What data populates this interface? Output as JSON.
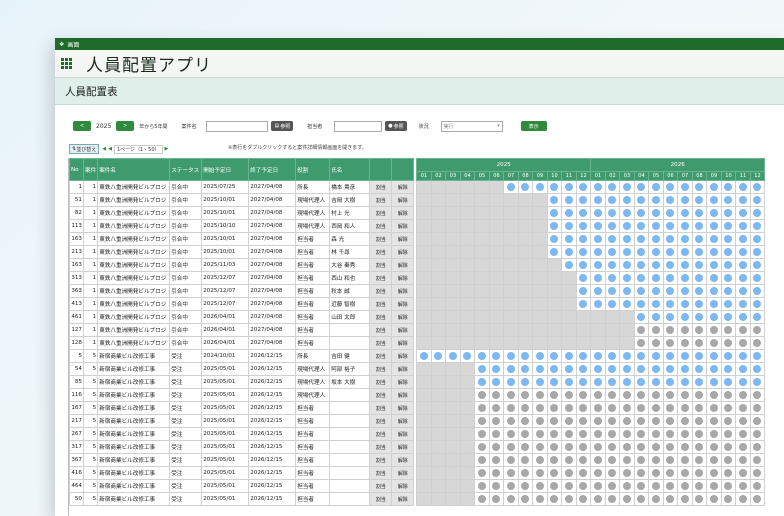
{
  "window_title": "画面",
  "app_title": "人員配置アプリ",
  "page_title": "人員配置表",
  "toolbar": {
    "prev": "<",
    "year": "2025",
    "next": ">",
    "range_label": "年から5年間",
    "project_label": "案件名",
    "project_value": "",
    "ref_label": "参照",
    "person_label": "担当者",
    "person_value": "",
    "person_ref_label": "参照",
    "status_label": "状況",
    "status_value": "実行",
    "show_label": "表示"
  },
  "pager": {
    "sort_label": "並び替え",
    "page_text": "1ページ（1 - 50）"
  },
  "note": "※表行をダブルクリックすると案件詳細情報画面を開きます。",
  "columns": [
    "No",
    "案件",
    "案件名",
    "ステータス",
    "開始予定日",
    "終了予定日",
    "役割",
    "氏名",
    "",
    ""
  ],
  "years": [
    {
      "label": "2025"
    },
    {
      "label": "2026"
    }
  ],
  "months": [
    "01",
    "02",
    "03",
    "04",
    "05",
    "06",
    "07",
    "08",
    "09",
    "10",
    "11",
    "12",
    "01",
    "02",
    "03",
    "04",
    "05",
    "06",
    "07",
    "08",
    "09",
    "10",
    "11",
    "12"
  ],
  "rows": [
    {
      "no": "1",
      "pid": "1",
      "name": "東鉄八重洲開発ビルプロジ",
      "status": "引合中",
      "start": "2025/07/25",
      "end": "2027/04/08",
      "role": "所長",
      "person": "橋本 貴彦",
      "b1": "割当",
      "b2": "解除",
      "color": "b",
      "from": 7
    },
    {
      "no": "51",
      "pid": "1",
      "name": "東鉄八重洲開発ビルプロジ",
      "status": "引合中",
      "start": "2025/10/01",
      "end": "2027/04/08",
      "role": "現場代理人",
      "person": "吉岡 大樹",
      "b1": "割当",
      "b2": "解除",
      "color": "b",
      "from": 10
    },
    {
      "no": "82",
      "pid": "1",
      "name": "東鉄八重洲開発ビルプロジ",
      "status": "引合中",
      "start": "2025/10/01",
      "end": "2027/04/08",
      "role": "現場代理人",
      "person": "村上 光",
      "b1": "割当",
      "b2": "解除",
      "color": "b",
      "from": 10
    },
    {
      "no": "113",
      "pid": "1",
      "name": "東鉄八重洲開発ビルプロジ",
      "status": "引合中",
      "start": "2025/10/10",
      "end": "2027/04/08",
      "role": "現場代理人",
      "person": "西岡 和人",
      "b1": "割当",
      "b2": "解除",
      "color": "b",
      "from": 10
    },
    {
      "no": "163",
      "pid": "1",
      "name": "東鉄八重洲開発ビルプロジ",
      "status": "引合中",
      "start": "2025/10/01",
      "end": "2027/04/08",
      "role": "担当者",
      "person": "森 光",
      "b1": "割当",
      "b2": "解除",
      "color": "b",
      "from": 10
    },
    {
      "no": "213",
      "pid": "1",
      "name": "東鉄八重洲開発ビルプロジ",
      "status": "引合中",
      "start": "2025/10/01",
      "end": "2027/04/08",
      "role": "担当者",
      "person": "林 千尋",
      "b1": "割当",
      "b2": "解除",
      "color": "b",
      "from": 10
    },
    {
      "no": "163",
      "pid": "1",
      "name": "東鉄八重洲開発ビルプロジ",
      "status": "引合中",
      "start": "2025/11/03",
      "end": "2027/04/08",
      "role": "担当者",
      "person": "大谷 秦秀",
      "b1": "割当",
      "b2": "解除",
      "color": "b",
      "from": 11
    },
    {
      "no": "313",
      "pid": "1",
      "name": "東鉄八重洲開発ビルプロジ",
      "status": "引合中",
      "start": "2025/12/07",
      "end": "2027/04/08",
      "role": "担当者",
      "person": "西山 和也",
      "b1": "割当",
      "b2": "解除",
      "color": "b",
      "from": 12
    },
    {
      "no": "363",
      "pid": "1",
      "name": "東鉄八重洲開発ビルプロジ",
      "status": "引合中",
      "start": "2025/12/07",
      "end": "2027/04/08",
      "role": "担当者",
      "person": "秋本 誠",
      "b1": "割当",
      "b2": "解除",
      "color": "b",
      "from": 12
    },
    {
      "no": "413",
      "pid": "1",
      "name": "東鉄八重洲開発ビルプロジ",
      "status": "引合中",
      "start": "2025/12/07",
      "end": "2027/04/08",
      "role": "担当者",
      "person": "近藤 智樹",
      "b1": "割当",
      "b2": "解除",
      "color": "b",
      "from": 12
    },
    {
      "no": "461",
      "pid": "1",
      "name": "東鉄八重洲開発ビルプロジ",
      "status": "引合中",
      "start": "2026/04/01",
      "end": "2027/04/08",
      "role": "担当者",
      "person": "山田 太郎",
      "b1": "割当",
      "b2": "解除",
      "color": "b",
      "from": 16
    },
    {
      "no": "127",
      "pid": "1",
      "name": "東鉄八重洲開発ビルプロジ",
      "status": "引合中",
      "start": "2026/04/01",
      "end": "2027/04/08",
      "role": "担当者",
      "person": "",
      "b1": "割当",
      "b2": "解除",
      "color": "g",
      "from": 16
    },
    {
      "no": "128",
      "pid": "1",
      "name": "東鉄八重洲開発ビルプロジ",
      "status": "引合中",
      "start": "2026/04/01",
      "end": "2027/04/08",
      "role": "担当者",
      "person": "",
      "b1": "割当",
      "b2": "解除",
      "color": "g",
      "from": 16
    },
    {
      "no": "5",
      "pid": "5",
      "name": "新宿商業ビル改修工事",
      "status": "受注",
      "start": "2024/10/01",
      "end": "2026/12/15",
      "role": "所長",
      "person": "吉田 健",
      "b1": "割当",
      "b2": "解除",
      "color": "b",
      "from": 1
    },
    {
      "no": "54",
      "pid": "5",
      "name": "新宿商業ビル改修工事",
      "status": "受注",
      "start": "2025/05/01",
      "end": "2026/12/15",
      "role": "現場代理人",
      "person": "阿部 裕子",
      "b1": "割当",
      "b2": "解除",
      "color": "b",
      "from": 5
    },
    {
      "no": "85",
      "pid": "5",
      "name": "新宿商業ビル改修工事",
      "status": "受注",
      "start": "2025/05/01",
      "end": "2026/12/15",
      "role": "現場代理人",
      "person": "坂本 大樹",
      "b1": "割当",
      "b2": "解除",
      "color": "b",
      "from": 5
    },
    {
      "no": "116",
      "pid": "5",
      "name": "新宿商業ビル改修工事",
      "status": "受注",
      "start": "2025/05/01",
      "end": "2026/12/15",
      "role": "現場代理人",
      "person": "",
      "b1": "割当",
      "b2": "解除",
      "color": "g",
      "from": 5
    },
    {
      "no": "167",
      "pid": "5",
      "name": "新宿商業ビル改修工事",
      "status": "受注",
      "start": "2025/05/01",
      "end": "2026/12/15",
      "role": "担当者",
      "person": "",
      "b1": "割当",
      "b2": "解除",
      "color": "g",
      "from": 5
    },
    {
      "no": "217",
      "pid": "5",
      "name": "新宿商業ビル改修工事",
      "status": "受注",
      "start": "2025/05/01",
      "end": "2026/12/15",
      "role": "担当者",
      "person": "",
      "b1": "割当",
      "b2": "解除",
      "color": "g",
      "from": 5
    },
    {
      "no": "267",
      "pid": "5",
      "name": "新宿商業ビル改修工事",
      "status": "受注",
      "start": "2025/05/01",
      "end": "2026/12/15",
      "role": "担当者",
      "person": "",
      "b1": "割当",
      "b2": "解除",
      "color": "g",
      "from": 5
    },
    {
      "no": "317",
      "pid": "5",
      "name": "新宿商業ビル改修工事",
      "status": "受注",
      "start": "2025/05/01",
      "end": "2026/12/15",
      "role": "担当者",
      "person": "",
      "b1": "割当",
      "b2": "解除",
      "color": "g",
      "from": 5
    },
    {
      "no": "367",
      "pid": "5",
      "name": "新宿商業ビル改修工事",
      "status": "受注",
      "start": "2025/05/01",
      "end": "2026/12/15",
      "role": "担当者",
      "person": "",
      "b1": "割当",
      "b2": "解除",
      "color": "g",
      "from": 5
    },
    {
      "no": "416",
      "pid": "5",
      "name": "新宿商業ビル改修工事",
      "status": "受注",
      "start": "2025/05/01",
      "end": "2026/12/15",
      "role": "担当者",
      "person": "",
      "b1": "割当",
      "b2": "解除",
      "color": "g",
      "from": 5
    },
    {
      "no": "464",
      "pid": "5",
      "name": "新宿商業ビル改修工事",
      "status": "受注",
      "start": "2025/05/01",
      "end": "2026/12/15",
      "role": "担当者",
      "person": "",
      "b1": "割当",
      "b2": "解除",
      "color": "g",
      "from": 5
    },
    {
      "no": "50",
      "pid": "5",
      "name": "新宿商業ビル改修工事",
      "status": "受注",
      "start": "2025/05/01",
      "end": "2026/12/15",
      "role": "担当者",
      "person": "",
      "b1": "割当",
      "b2": "解除",
      "color": "g",
      "from": 5
    }
  ]
}
